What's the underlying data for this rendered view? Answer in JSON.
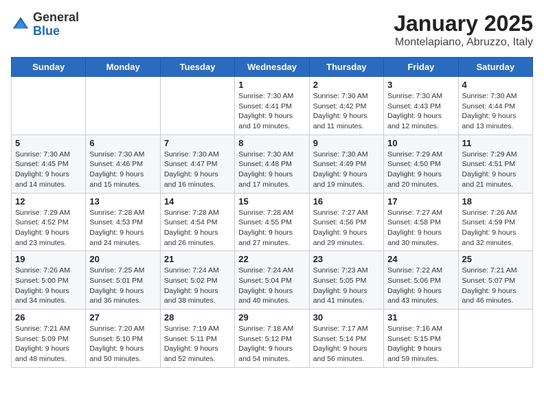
{
  "logo": {
    "general": "General",
    "blue": "Blue"
  },
  "title": "January 2025",
  "subtitle": "Montelapiano, Abruzzo, Italy",
  "days": [
    "Sunday",
    "Monday",
    "Tuesday",
    "Wednesday",
    "Thursday",
    "Friday",
    "Saturday"
  ],
  "weeks": [
    [
      {
        "date": "",
        "info": ""
      },
      {
        "date": "",
        "info": ""
      },
      {
        "date": "",
        "info": ""
      },
      {
        "date": "1",
        "info": "Sunrise: 7:30 AM\nSunset: 4:41 PM\nDaylight: 9 hours\nand 10 minutes."
      },
      {
        "date": "2",
        "info": "Sunrise: 7:30 AM\nSunset: 4:42 PM\nDaylight: 9 hours\nand 11 minutes."
      },
      {
        "date": "3",
        "info": "Sunrise: 7:30 AM\nSunset: 4:43 PM\nDaylight: 9 hours\nand 12 minutes."
      },
      {
        "date": "4",
        "info": "Sunrise: 7:30 AM\nSunset: 4:44 PM\nDaylight: 9 hours\nand 13 minutes."
      }
    ],
    [
      {
        "date": "5",
        "info": "Sunrise: 7:30 AM\nSunset: 4:45 PM\nDaylight: 9 hours\nand 14 minutes."
      },
      {
        "date": "6",
        "info": "Sunrise: 7:30 AM\nSunset: 4:46 PM\nDaylight: 9 hours\nand 15 minutes."
      },
      {
        "date": "7",
        "info": "Sunrise: 7:30 AM\nSunset: 4:47 PM\nDaylight: 9 hours\nand 16 minutes."
      },
      {
        "date": "8",
        "info": "Sunrise: 7:30 AM\nSunset: 4:48 PM\nDaylight: 9 hours\nand 17 minutes."
      },
      {
        "date": "9",
        "info": "Sunrise: 7:30 AM\nSunset: 4:49 PM\nDaylight: 9 hours\nand 19 minutes."
      },
      {
        "date": "10",
        "info": "Sunrise: 7:29 AM\nSunset: 4:50 PM\nDaylight: 9 hours\nand 20 minutes."
      },
      {
        "date": "11",
        "info": "Sunrise: 7:29 AM\nSunset: 4:51 PM\nDaylight: 9 hours\nand 21 minutes."
      }
    ],
    [
      {
        "date": "12",
        "info": "Sunrise: 7:29 AM\nSunset: 4:52 PM\nDaylight: 9 hours\nand 23 minutes."
      },
      {
        "date": "13",
        "info": "Sunrise: 7:28 AM\nSunset: 4:53 PM\nDaylight: 9 hours\nand 24 minutes."
      },
      {
        "date": "14",
        "info": "Sunrise: 7:28 AM\nSunset: 4:54 PM\nDaylight: 9 hours\nand 26 minutes."
      },
      {
        "date": "15",
        "info": "Sunrise: 7:28 AM\nSunset: 4:55 PM\nDaylight: 9 hours\nand 27 minutes."
      },
      {
        "date": "16",
        "info": "Sunrise: 7:27 AM\nSunset: 4:56 PM\nDaylight: 9 hours\nand 29 minutes."
      },
      {
        "date": "17",
        "info": "Sunrise: 7:27 AM\nSunset: 4:58 PM\nDaylight: 9 hours\nand 30 minutes."
      },
      {
        "date": "18",
        "info": "Sunrise: 7:26 AM\nSunset: 4:59 PM\nDaylight: 9 hours\nand 32 minutes."
      }
    ],
    [
      {
        "date": "19",
        "info": "Sunrise: 7:26 AM\nSunset: 5:00 PM\nDaylight: 9 hours\nand 34 minutes."
      },
      {
        "date": "20",
        "info": "Sunrise: 7:25 AM\nSunset: 5:01 PM\nDaylight: 9 hours\nand 36 minutes."
      },
      {
        "date": "21",
        "info": "Sunrise: 7:24 AM\nSunset: 5:02 PM\nDaylight: 9 hours\nand 38 minutes."
      },
      {
        "date": "22",
        "info": "Sunrise: 7:24 AM\nSunset: 5:04 PM\nDaylight: 9 hours\nand 40 minutes."
      },
      {
        "date": "23",
        "info": "Sunrise: 7:23 AM\nSunset: 5:05 PM\nDaylight: 9 hours\nand 41 minutes."
      },
      {
        "date": "24",
        "info": "Sunrise: 7:22 AM\nSunset: 5:06 PM\nDaylight: 9 hours\nand 43 minutes."
      },
      {
        "date": "25",
        "info": "Sunrise: 7:21 AM\nSunset: 5:07 PM\nDaylight: 9 hours\nand 46 minutes."
      }
    ],
    [
      {
        "date": "26",
        "info": "Sunrise: 7:21 AM\nSunset: 5:09 PM\nDaylight: 9 hours\nand 48 minutes."
      },
      {
        "date": "27",
        "info": "Sunrise: 7:20 AM\nSunset: 5:10 PM\nDaylight: 9 hours\nand 50 minutes."
      },
      {
        "date": "28",
        "info": "Sunrise: 7:19 AM\nSunset: 5:11 PM\nDaylight: 9 hours\nand 52 minutes."
      },
      {
        "date": "29",
        "info": "Sunrise: 7:18 AM\nSunset: 5:12 PM\nDaylight: 9 hours\nand 54 minutes."
      },
      {
        "date": "30",
        "info": "Sunrise: 7:17 AM\nSunset: 5:14 PM\nDaylight: 9 hours\nand 56 minutes."
      },
      {
        "date": "31",
        "info": "Sunrise: 7:16 AM\nSunset: 5:15 PM\nDaylight: 9 hours\nand 59 minutes."
      },
      {
        "date": "",
        "info": ""
      }
    ]
  ]
}
